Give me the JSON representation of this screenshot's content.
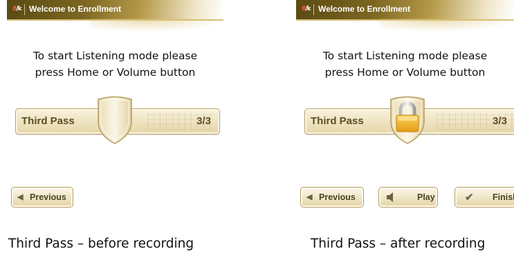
{
  "screens": [
    {
      "header_title": "Welcome to Enrollment",
      "instruction_line1": "To start Listening mode please",
      "instruction_line2": "press Home or Volume button",
      "pass_label": "Third Pass",
      "pass_count": "3/3",
      "shield_state": "empty",
      "buttons": [
        {
          "label": "Previous",
          "icon": "left-arrow-icon"
        }
      ],
      "caption": "Third Pass – before recording"
    },
    {
      "header_title": "Welcome to Enrollment",
      "instruction_line1": "To start Listening mode please",
      "instruction_line2": "press Home or Volume button",
      "pass_label": "Third Pass",
      "pass_count": "3/3",
      "shield_state": "locked",
      "buttons": [
        {
          "label": "Previous",
          "icon": "left-arrow-icon"
        },
        {
          "label": "Play",
          "icon": "speaker-icon"
        },
        {
          "label": "Finish",
          "icon": "checkmark-icon"
        }
      ],
      "caption": "Third Pass – after recording"
    }
  ],
  "colors": {
    "header_dark": "#5a4a12",
    "header_gold": "#b59a4a",
    "bar_light": "#f8f2de",
    "bar_dark": "#e6d6a8",
    "lock_gold": "#f2b632"
  }
}
